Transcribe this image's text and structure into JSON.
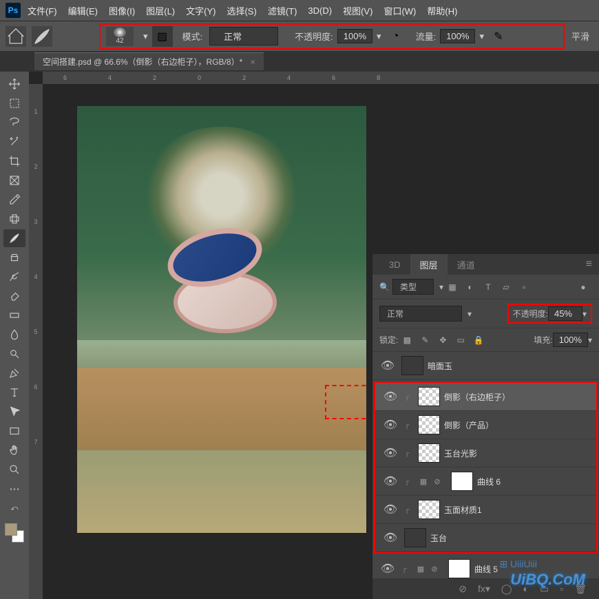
{
  "menubar": {
    "items": [
      "文件(F)",
      "编辑(E)",
      "图像(I)",
      "图层(L)",
      "文字(Y)",
      "选择(S)",
      "滤镜(T)",
      "3D(D)",
      "视图(V)",
      "窗口(W)",
      "帮助(H)"
    ]
  },
  "options": {
    "brush_size": "42",
    "mode_label": "模式:",
    "mode_value": "正常",
    "opacity_label": "不透明度:",
    "opacity_value": "100%",
    "flow_label": "流量:",
    "flow_value": "100%",
    "smooth_label": "平滑"
  },
  "tab": {
    "title": "空间搭建.psd @ 66.6%（倒影（右边柜子），RGB/8）*",
    "close": "×"
  },
  "annotation": "#aa9a7e",
  "ruler_h": [
    "6",
    "4",
    "2",
    "0",
    "2",
    "4",
    "6",
    "8"
  ],
  "ruler_v": [
    "1",
    "2",
    "3",
    "4",
    "5",
    "6",
    "7"
  ],
  "panel": {
    "tabs": [
      "3D",
      "图层",
      "通道"
    ],
    "search_label": "类型",
    "blend_mode": "正常",
    "opacity_label": "不透明度:",
    "opacity_value": "45%",
    "lock_label": "锁定:",
    "fill_label": "填充:",
    "fill_value": "100%"
  },
  "layers": [
    {
      "name": "暗面玉",
      "thumb": "dark",
      "selected": false,
      "indent": 0
    },
    {
      "name": "倒影（右边柜子）",
      "thumb": "checker",
      "selected": true,
      "indent": 1
    },
    {
      "name": "倒影（产品）",
      "thumb": "checker",
      "selected": false,
      "indent": 1
    },
    {
      "name": "玉台光影",
      "thumb": "checker",
      "selected": false,
      "indent": 1
    },
    {
      "name": "曲线 6",
      "thumb": "white",
      "selected": false,
      "indent": 1,
      "adj": true
    },
    {
      "name": "玉面材质1",
      "thumb": "checker",
      "selected": false,
      "indent": 1
    },
    {
      "name": "玉台",
      "thumb": "dark",
      "selected": false,
      "indent": 0
    },
    {
      "name": "曲线 5",
      "thumb": "white",
      "selected": false,
      "indent": 1,
      "adj": true
    }
  ],
  "watermark": "UiBQ.CoM",
  "watermark_grid": "⊞ UiiiUiii"
}
